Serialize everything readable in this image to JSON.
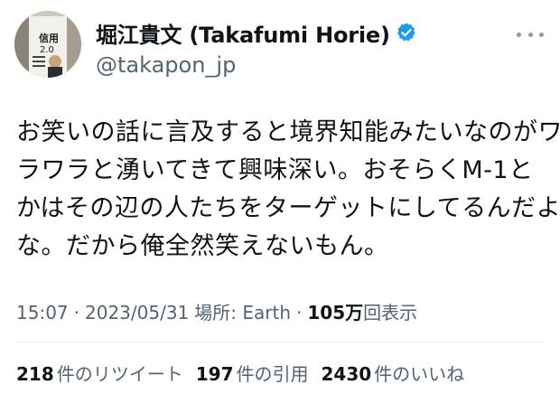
{
  "author": {
    "display_name": "堀江貴文 (Takafumi Horie)",
    "handle": "@takapon_jp",
    "avatar_book_text": "信用2.0"
  },
  "tweet": {
    "lines": [
      "お笑いの話に言及すると境界知能みたいなのがワ",
      "ラワラと湧いてきて興味深い。おそらくM-1と",
      "かはその辺の人たちをターゲットにしてるんだよ",
      "な。だから俺全然笑えないもん。"
    ]
  },
  "meta": {
    "time": "15:07",
    "date": "2023/05/31",
    "location": "場所: Earth",
    "views_number": "105万",
    "views_label": "回表示"
  },
  "stats": [
    {
      "number": "218",
      "label": "件のリツイート"
    },
    {
      "number": "197",
      "label": "件の引用"
    },
    {
      "number": "2430",
      "label": "件のいいね"
    }
  ],
  "colors": {
    "verified_blue": "#1d9bf0",
    "secondary_text": "#536471",
    "primary_text": "#0f1419"
  }
}
